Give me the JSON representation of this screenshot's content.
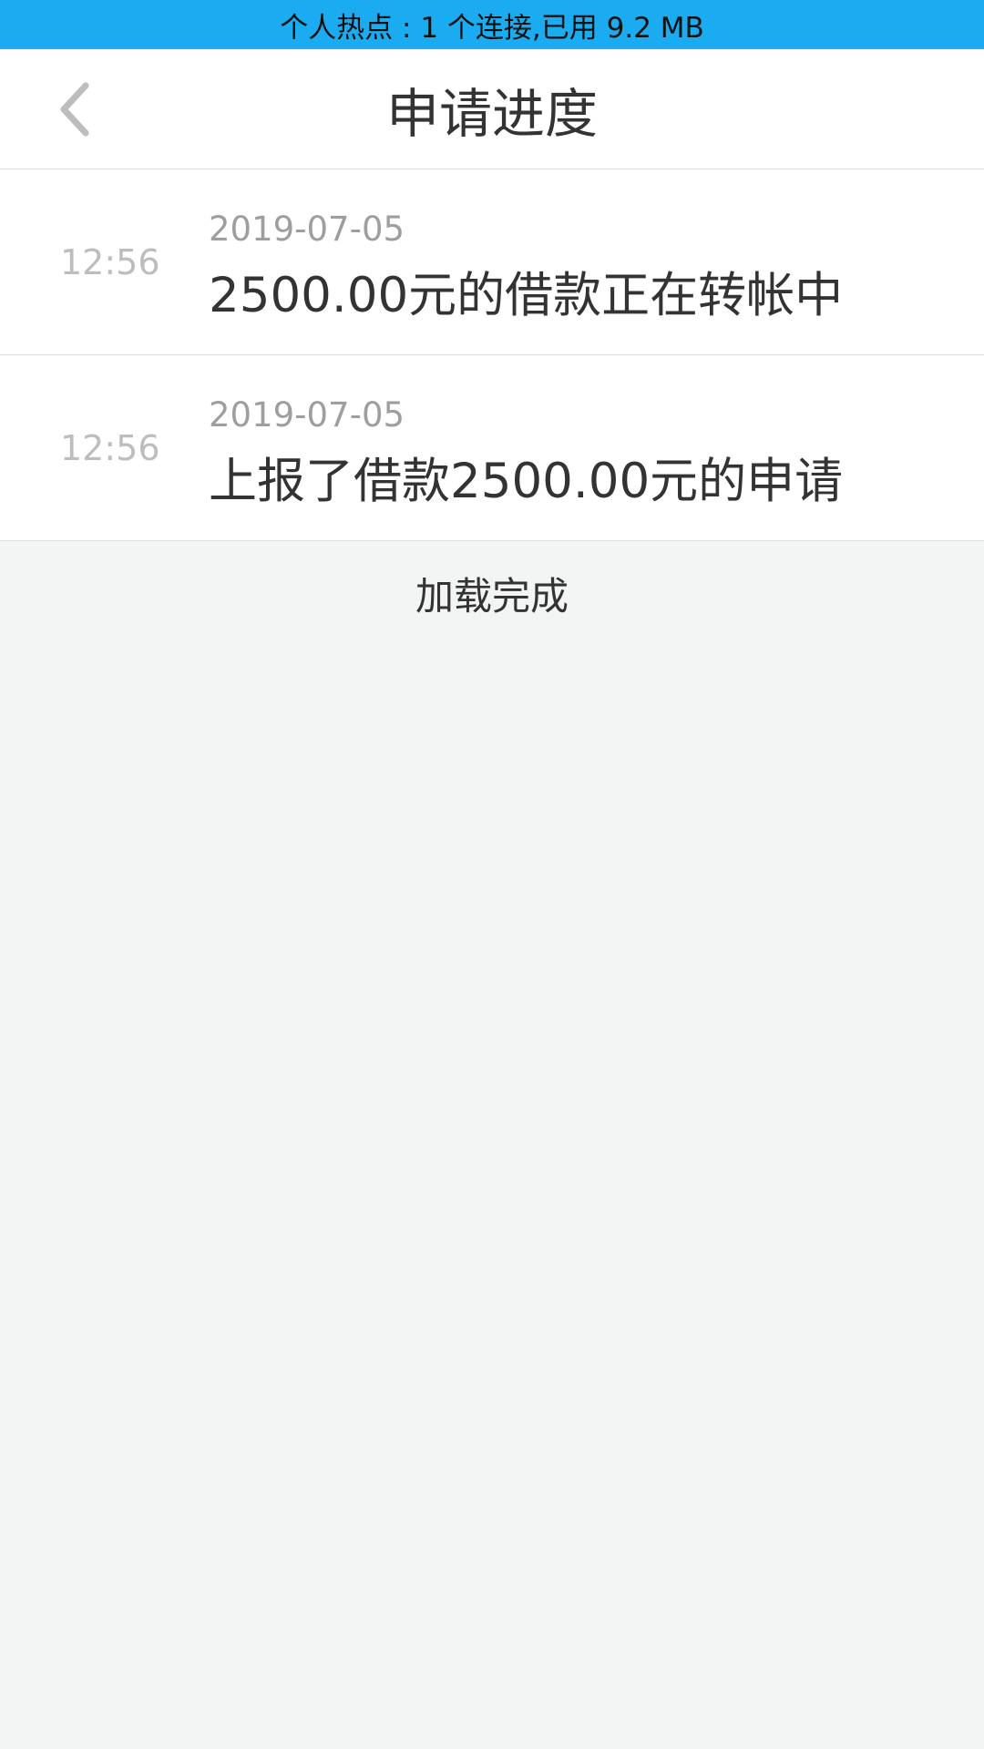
{
  "status_bar": {
    "text": "个人热点 : 1 个连接,已用 9.2 MB"
  },
  "header": {
    "title": "申请进度",
    "back_icon": "chevron-left-icon"
  },
  "records": [
    {
      "time": "12:56",
      "date": "2019-07-05",
      "text": "2500.00元的借款正在转帐中"
    },
    {
      "time": "12:56",
      "date": "2019-07-05",
      "text": "上报了借款2500.00元的申请"
    }
  ],
  "footer": {
    "load_status": "加载完成"
  },
  "colors": {
    "status_bar_bg": "#1aabf0",
    "page_bg": "#f3f4f4"
  }
}
